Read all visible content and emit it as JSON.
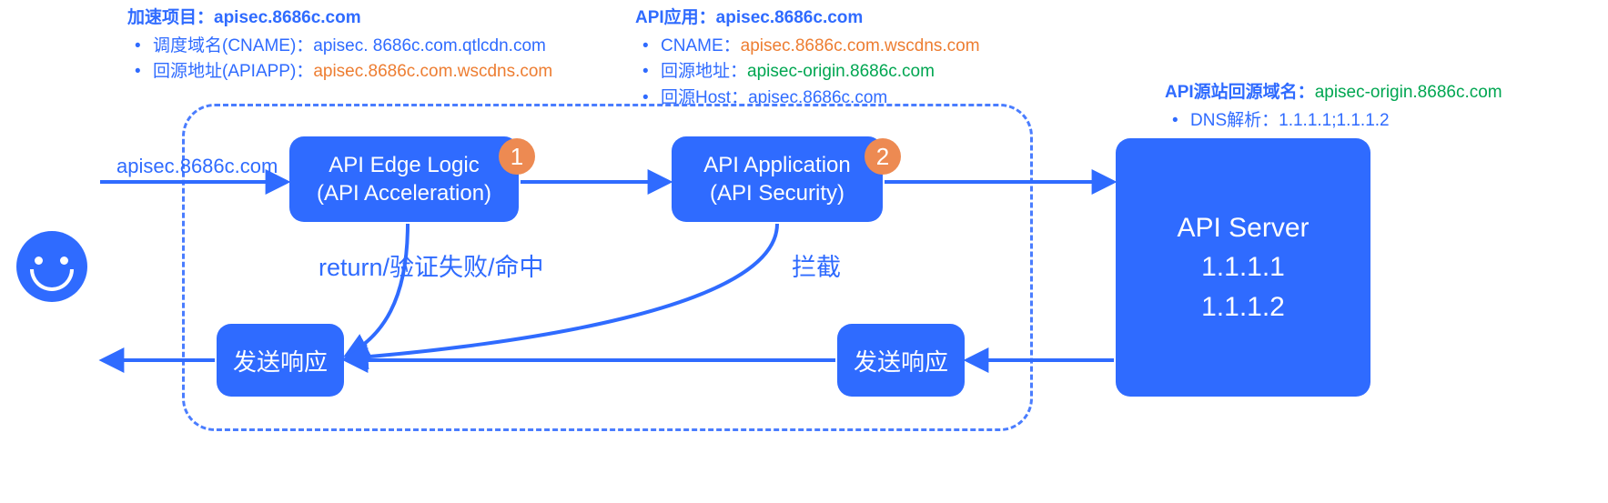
{
  "header_left": {
    "title": "加速项目：apisec.8686c.com",
    "item1_label": "调度域名(CNAME)：",
    "item1_value": "apisec. 8686c.com.qtlcdn.com",
    "item2_label": "回源地址(APIAPP)：",
    "item2_value": "apisec.8686c.com.wscdns.com"
  },
  "header_mid": {
    "title": "API应用：apisec.8686c.com",
    "item1_label": "CNAME：",
    "item1_value": "apisec.8686c.com.wscdns.com",
    "item2_label": "回源地址：",
    "item2_value": "apisec-origin.8686c.com",
    "item3_label": "回源Host：",
    "item3_value": "apisec.8686c.com"
  },
  "header_right": {
    "title_label": "API源站回源域名：",
    "title_value": "apisec-origin.8686c.com",
    "item1_label": "DNS解析：",
    "item1_value": "1.1.1.1;1.1.1.2"
  },
  "incoming_domain": "apisec.8686c.com",
  "box_edge_line1": "API Edge Logic",
  "box_edge_line2": "(API Acceleration)",
  "box_app_line1": "API Application",
  "box_app_line2": "(API Security)",
  "badge1": "1",
  "badge2": "2",
  "caption_return": "return/验证失败/命中",
  "caption_block": "拦截",
  "resp_label": "发送响应",
  "server_line1": "API Server",
  "server_line2": "1.1.1.1",
  "server_line3": "1.1.1.2"
}
